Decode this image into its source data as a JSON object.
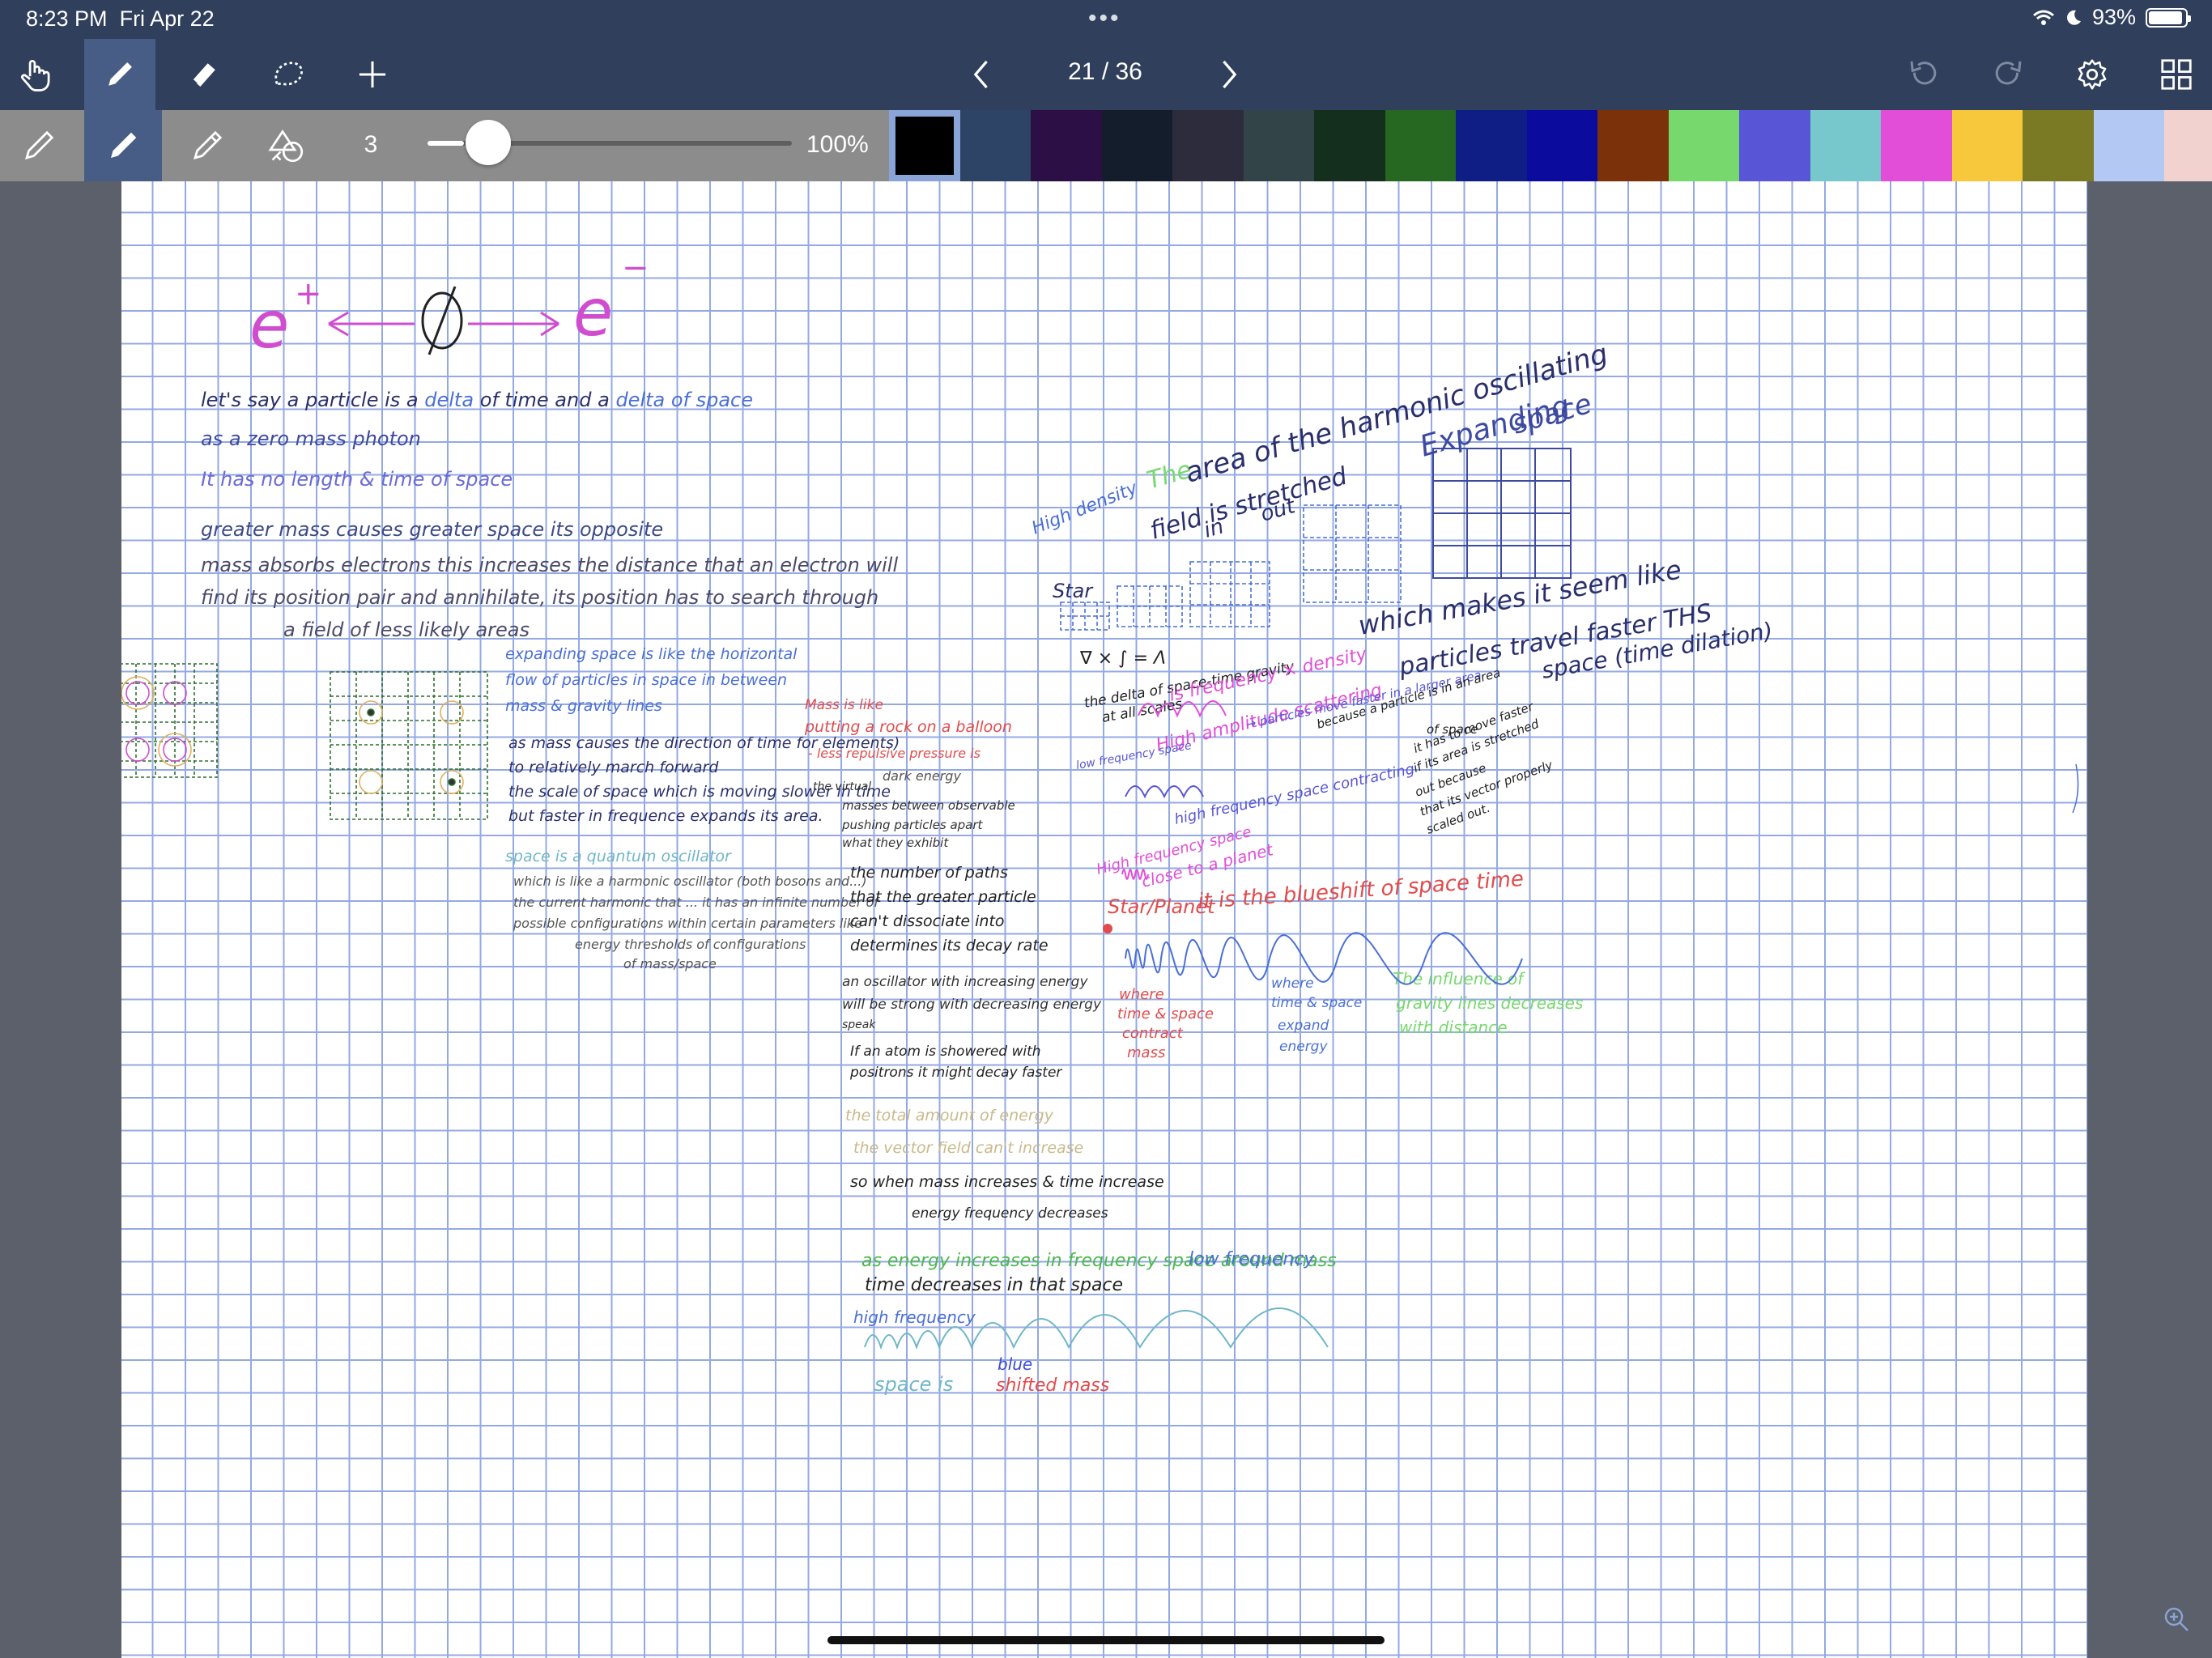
{
  "status_bar": {
    "time": "8:23 PM",
    "date": "Fri Apr 22",
    "multitask_dots": "•••",
    "battery": "93%",
    "battery_level": 0.93,
    "wifi_icon": "wifi-icon",
    "moon_icon": "moon-icon"
  },
  "toolbar": {
    "tools": [
      "hand-icon",
      "pen-icon",
      "eraser-icon",
      "lasso-icon",
      "plus-icon"
    ],
    "active_tool": "pen",
    "page_indicator": "21 / 36",
    "right_tools": [
      "undo-icon",
      "redo-icon",
      "gear-icon",
      "grid-icon"
    ]
  },
  "pen_bar": {
    "pen_types": [
      "fountain-pen-icon",
      "ballpoint-icon",
      "pencil-icon",
      "shapes-icon"
    ],
    "active_pen": "ballpoint",
    "size": "3",
    "size_level": 0.1,
    "opacity": "100%",
    "swatches": [
      "#000000",
      "#2e4466",
      "#2b0f45",
      "#141d2c",
      "#2c2c3c",
      "#324448",
      "#142f1d",
      "#266722",
      "#0f1e84",
      "#0b0b9e",
      "#7b3109",
      "#77d96d",
      "#5856d6",
      "#76c8cd",
      "#e24ed7",
      "#f8c83c",
      "#7a7a25",
      "#b3c9f3",
      "#f2d2cf"
    ],
    "selected_swatch": 0
  },
  "notes": {
    "equation_left": "e",
    "equation_sup": "+",
    "equation_right": "e",
    "equation_sup_right": "−",
    "l1_a": "let's say a particle is a",
    "l1_b": "delta",
    "l1_c": "of time and a",
    "l1_d": "delta of space",
    "l2": "as a zero mass photon",
    "l3": "It has no length & time of space",
    "l4": "greater mass causes greater space its opposite",
    "l5": "mass absorbs electrons this increases the distance that an electron will",
    "l6": "find its position pair and annihilate, its position has to search through",
    "l7": "a field of less likely areas",
    "b1": "expanding space is like the horizontal",
    "b2": "flow of particles in space in between",
    "b3": "mass & gravity lines",
    "b4": "as mass causes the direction of time for elements)",
    "b5": "to relatively march forward",
    "b6": "the scale of space which is moving slower in time",
    "b7": "but faster in frequence expands its area.",
    "c1": "space is a quantum oscillator",
    "c2": "which is like a harmonic oscillator (both bosons and...)",
    "c3": "the current harmonic that ... it has an infinite number of",
    "c4": "possible configurations within certain parameters like",
    "c5": "energy thresholds of configurations",
    "c6": "of mass/space",
    "m1": "Mass is like",
    "m2": "putting a rock on a balloon",
    "m3": "- less repulsive pressure is",
    "m4": "dark energy",
    "m5": "the virtual",
    "m6": "masses between observable",
    "m7": "pushing particles apart",
    "m8": "what they exhibit",
    "m9": "the number of paths",
    "m10": "that the greater particle",
    "m11": "can't dissociate into",
    "m12": "determines its decay rate",
    "m13": "an oscillator with increasing energy",
    "m14": "will be strong with decreasing energy",
    "m15": "speak",
    "m16": "If an atom is showered with",
    "m17": "positrons it might decay faster",
    "m18": "the total amount of energy",
    "m19": "the vector field can't increase",
    "m20": "so when mass increases & time increase",
    "m21": "energy frequency decreases",
    "m22": "as energy increases in frequency space around mass",
    "m23": "time decreases in that space",
    "m24": "high frequency",
    "m25": "low frequency",
    "m26": "space is",
    "m27": "blue",
    "m28": "shifted mass",
    "r1": "High density",
    "r2": "The",
    "r3": "area of the harmonic oscillating",
    "r4": "field is stretched",
    "r5": "in",
    "r6": "out",
    "r7": "Expanding",
    "r8": "space",
    "r9": "Star",
    "r10": "which makes it seem like",
    "r11": "particles travel faster THS",
    "r12": "space (time dilation)",
    "r13": "∇ × ∫ = Λ",
    "r14": "the delta of space-time gravity",
    "r15": "at all scales",
    "r16": "is frequency × density",
    "r17": "High amplitude scattering",
    "r18": "→ particles move faster in a larger area",
    "r19": "because a particle is in an area",
    "r20": "of space",
    "r21": "it has to move faster",
    "r22": "if its area is stretched",
    "r23": "out because",
    "r24": "that its vector properly",
    "r25": "scaled out.",
    "r26": "low frequency space",
    "r27": "high frequency space contracting",
    "r28": "High frequency space",
    "r29": "close to a planet",
    "r30": "Star/Planet",
    "r31": "it is the blueshift of space time",
    "r32": "where",
    "r33": "time & space",
    "r34": "contract",
    "r35": "mass",
    "r36": "where",
    "r37": "time & space",
    "r38": "expand",
    "r39": "energy",
    "r40": "The influence of",
    "r41": "gravity lines decreases",
    "r42": "with distance."
  }
}
